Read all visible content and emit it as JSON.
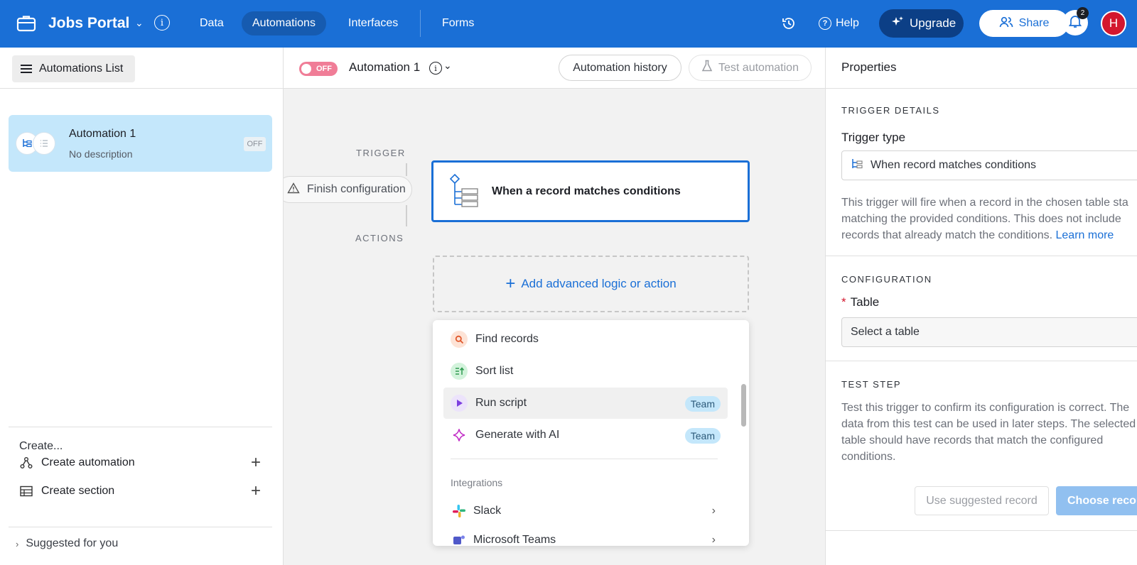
{
  "topbar": {
    "app_title": "Jobs Portal",
    "nav": [
      "Data",
      "Automations",
      "Interfaces",
      "Forms"
    ],
    "active_nav": "Automations",
    "help_label": "Help",
    "upgrade_label": "Upgrade",
    "share_label": "Share",
    "notification_count": "2",
    "avatar_initial": "H",
    "colors": {
      "bar": "#1a6fd6",
      "active_nav": "#165bb0",
      "upgrade": "#0c3f86",
      "avatar": "#d3172e"
    }
  },
  "left": {
    "list_button_label": "Automations List",
    "automation": {
      "title": "Automation 1",
      "description": "No description",
      "status": "OFF"
    },
    "create_title": "Create...",
    "create_automation_label": "Create automation",
    "create_section_label": "Create section",
    "suggested_label": "Suggested for you"
  },
  "center": {
    "toggle_label": "OFF",
    "automation_name": "Automation 1",
    "history_button": "Automation history",
    "test_button": "Test automation",
    "trigger_label": "TRIGGER",
    "actions_label": "ACTIONS",
    "finish_label": "Finish configuration",
    "trigger_card_text": "When a record matches conditions",
    "add_action_label": "Add advanced logic or action",
    "menu": {
      "items": [
        {
          "label": "Find records",
          "icon": "search-icon"
        },
        {
          "label": "Sort list",
          "icon": "sort-icon"
        },
        {
          "label": "Run script",
          "icon": "play-icon",
          "badge": "Team"
        },
        {
          "label": "Generate with AI",
          "icon": "sparkle-icon",
          "badge": "Team"
        }
      ],
      "section_title": "Integrations",
      "integrations": [
        {
          "label": "Slack",
          "icon": "slack-icon"
        },
        {
          "label": "Microsoft Teams",
          "icon": "teams-icon"
        }
      ]
    }
  },
  "right": {
    "header": "Properties",
    "trigger_details_title": "TRIGGER DETAILS",
    "trigger_type_label": "Trigger type",
    "trigger_type_value": "When record matches conditions",
    "trigger_description_lines": [
      "This trigger will fire when a record in the chosen table sta",
      "matching the provided conditions. This does not include",
      "records that already match the conditions."
    ],
    "learn_more": "Learn more",
    "configuration_title": "CONFIGURATION",
    "table_label": "Table",
    "table_placeholder": "Select a table",
    "test_step_title": "TEST STEP",
    "test_description_lines": [
      "Test this trigger to confirm its configuration is correct. The",
      "data from this test can be used in later steps. The selected",
      "table should have records that match the configured",
      "conditions."
    ],
    "use_suggested_button": "Use suggested record",
    "choose_record_button": "Choose recor"
  }
}
